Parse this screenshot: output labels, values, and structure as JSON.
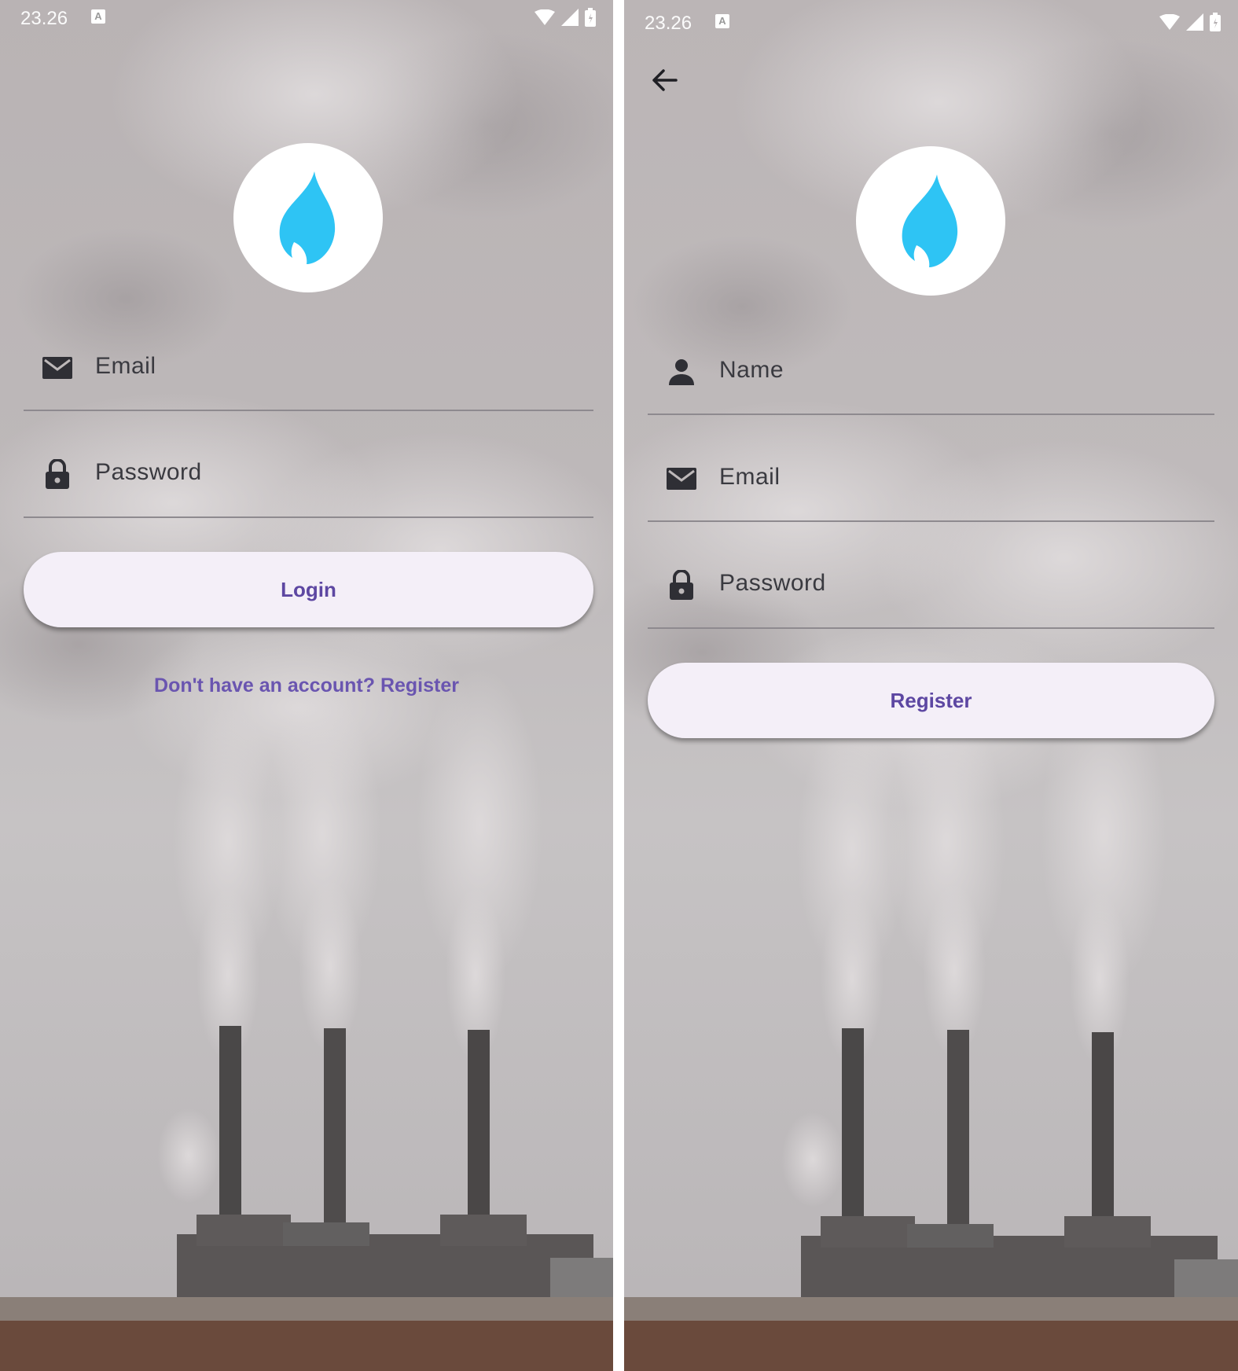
{
  "status_bar": {
    "time": "23.26",
    "notification_letter": "A",
    "icons": [
      "wifi-icon",
      "signal-icon",
      "battery-icon"
    ]
  },
  "login": {
    "email_label": "Email",
    "password_label": "Password",
    "login_button": "Login",
    "register_link": "Don't have an account? Register",
    "icons": {
      "email": "envelope-icon",
      "password": "lock-icon",
      "logo": "flame-icon"
    }
  },
  "register": {
    "name_label": "Name",
    "email_label": "Email",
    "password_label": "Password",
    "register_button": "Register",
    "icons": {
      "back": "back-arrow-icon",
      "name": "person-icon",
      "email": "envelope-icon",
      "password": "lock-icon",
      "logo": "flame-icon"
    }
  },
  "colors": {
    "accent": "#5d47a2",
    "button_bg": "#f4eff8",
    "flame": "#2ec4f4",
    "field_underline": "#8e8a8f"
  }
}
